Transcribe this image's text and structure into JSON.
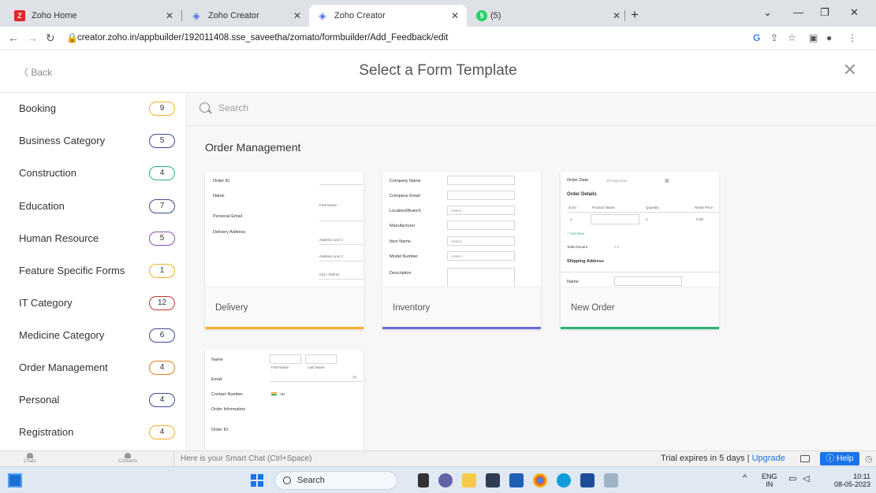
{
  "browser": {
    "tabs": [
      {
        "title": "Zoho Home",
        "icon": "zoho-icon",
        "color": "#e42527",
        "glyph": "Z"
      },
      {
        "title": "Zoho Creator",
        "icon": "zoho-creator-icon",
        "color": "#ffffff",
        "glyph": "◈"
      },
      {
        "title": "Zoho Creator",
        "icon": "zoho-creator-icon",
        "color": "#ffffff",
        "glyph": "◈"
      },
      {
        "title": "(5) WhatsApp",
        "icon": "whatsapp-icon",
        "color": "#25d366",
        "glyph": "✆"
      }
    ],
    "url": "creator.zoho.in/appbuilder/192011408.sse_saveetha/zomato/formbuilder/Add_Feedback/edit"
  },
  "header": {
    "back_label": "Back",
    "title": "Select a Form Template"
  },
  "sidebar": {
    "categories": [
      {
        "label": "Booking",
        "count": "9",
        "color": "#f2b02b"
      },
      {
        "label": "Business Category",
        "count": "5",
        "color": "#3e4b8c"
      },
      {
        "label": "Construction",
        "count": "4",
        "color": "#2bb673"
      },
      {
        "label": "Education",
        "count": "7",
        "color": "#3e4b8c"
      },
      {
        "label": "Human Resource",
        "count": "5",
        "color": "#8a4fb0"
      },
      {
        "label": "Feature Specific Forms",
        "count": "1",
        "color": "#f2b02b"
      },
      {
        "label": "IT Category",
        "count": "12",
        "color": "#c0392b"
      },
      {
        "label": "Medicine Category",
        "count": "6",
        "color": "#3e4b8c"
      },
      {
        "label": "Order Management",
        "count": "4",
        "color": "#e67e22"
      },
      {
        "label": "Personal",
        "count": "4",
        "color": "#3e4b8c"
      },
      {
        "label": "Registration",
        "count": "4",
        "color": "#f2b02b"
      }
    ]
  },
  "main": {
    "search_placeholder": "Search",
    "section_title": "Order Management",
    "templates": [
      {
        "name": "Delivery",
        "accent": "#f2b02b"
      },
      {
        "name": "Inventory",
        "accent": "#6c6cd9"
      },
      {
        "name": "New Order",
        "accent": "#2bb673"
      }
    ],
    "previews": {
      "delivery": {
        "order_id": "Order ID",
        "name": "Name",
        "first_name": "First Name",
        "personal_email": "Personal Email",
        "delivery_address": "Delivery Address",
        "address_line_1": "Address Line 1",
        "address_line_2": "Address Line 2",
        "city": "City / District"
      },
      "inventory": {
        "company_name": "Company Name",
        "company_email": "Company Email",
        "location": "Location/Branch",
        "manufacturer": "Manufacturer",
        "item_name": "Item Name",
        "model_number": "Model Number",
        "description": "Description",
        "select": "-Select-"
      },
      "new_order": {
        "order_date": "Order Date",
        "date_value": "29-Sep-2016",
        "order_details": "Order Details",
        "col_sno": "S.No",
        "col_product": "Product Name",
        "col_quantity": "Quantity",
        "col_price": "Retail Price",
        "row_sno": "1",
        "row_qty": "1",
        "row_price": "0.00",
        "add_new": "+ Add New",
        "total_amount": "Total Amount",
        "total_value": "0.0",
        "shipping_address": "Shipping Address",
        "name": "Name"
      },
      "fourth": {
        "name": "Name",
        "first_name": "First Name",
        "last_name": "Last Name",
        "email": "Email",
        "contact_number": "Contact Number",
        "country_code": "+91",
        "order_information": "Order Information",
        "order_id": "Order ID"
      }
    }
  },
  "chatbar": {
    "chats": "Chats",
    "contacts": "Contacts",
    "smart_chat": "Here is your Smart Chat (Ctrl+Space)",
    "trial": "Trial expires in 5 days | ",
    "upgrade": "Upgrade",
    "help": "ⓘ Help"
  },
  "taskbar": {
    "search_label": "Search",
    "lang_top": "ENG",
    "lang_bottom": "IN",
    "time": "10:11",
    "date": "08-05-2023"
  }
}
